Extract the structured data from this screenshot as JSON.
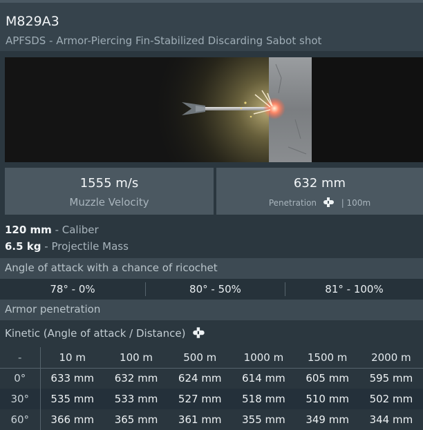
{
  "shell": {
    "name": "M829A3",
    "type_desc": "APFSDS - Armor-Piercing Fin-Stabilized Discarding Sabot shot"
  },
  "stats": {
    "muzzle_velocity_value": "1555 m/s",
    "muzzle_velocity_label": "Muzzle Velocity",
    "penetration_value": "632 mm",
    "penetration_label": "Penetration",
    "penetration_distance": "| 100m"
  },
  "specs": {
    "caliber_value": "120 mm",
    "caliber_label": "- Caliber",
    "mass_value": "6.5 kg",
    "mass_label": "- Projectile Mass"
  },
  "ricochet": {
    "heading": "Angle of attack with a chance of ricochet",
    "cells": [
      "78° - 0%",
      "80° - 50%",
      "81° - 100%"
    ]
  },
  "armor": {
    "heading": "Armor penetration",
    "kinetic_label": "Kinetic (Angle of attack / Distance)",
    "corner": "-",
    "distances": [
      "10 m",
      "100 m",
      "500 m",
      "1000 m",
      "1500 m",
      "2000 m"
    ],
    "rows": [
      {
        "angle": "0°",
        "values": [
          "633 mm",
          "632 mm",
          "624 mm",
          "614 mm",
          "605 mm",
          "595 mm"
        ]
      },
      {
        "angle": "30°",
        "values": [
          "535 mm",
          "533 mm",
          "527 mm",
          "518 mm",
          "510 mm",
          "502 mm"
        ]
      },
      {
        "angle": "60°",
        "values": [
          "366 mm",
          "365 mm",
          "361 mm",
          "355 mm",
          "349 mm",
          "344 mm"
        ]
      }
    ]
  },
  "icons": {
    "penetration": "shell-icon",
    "kinetic": "shell-icon"
  },
  "colors": {
    "background": "#2b373f",
    "header": "#36434c",
    "stat_box": "#4b5861",
    "section_bar": "#3d4a53"
  }
}
